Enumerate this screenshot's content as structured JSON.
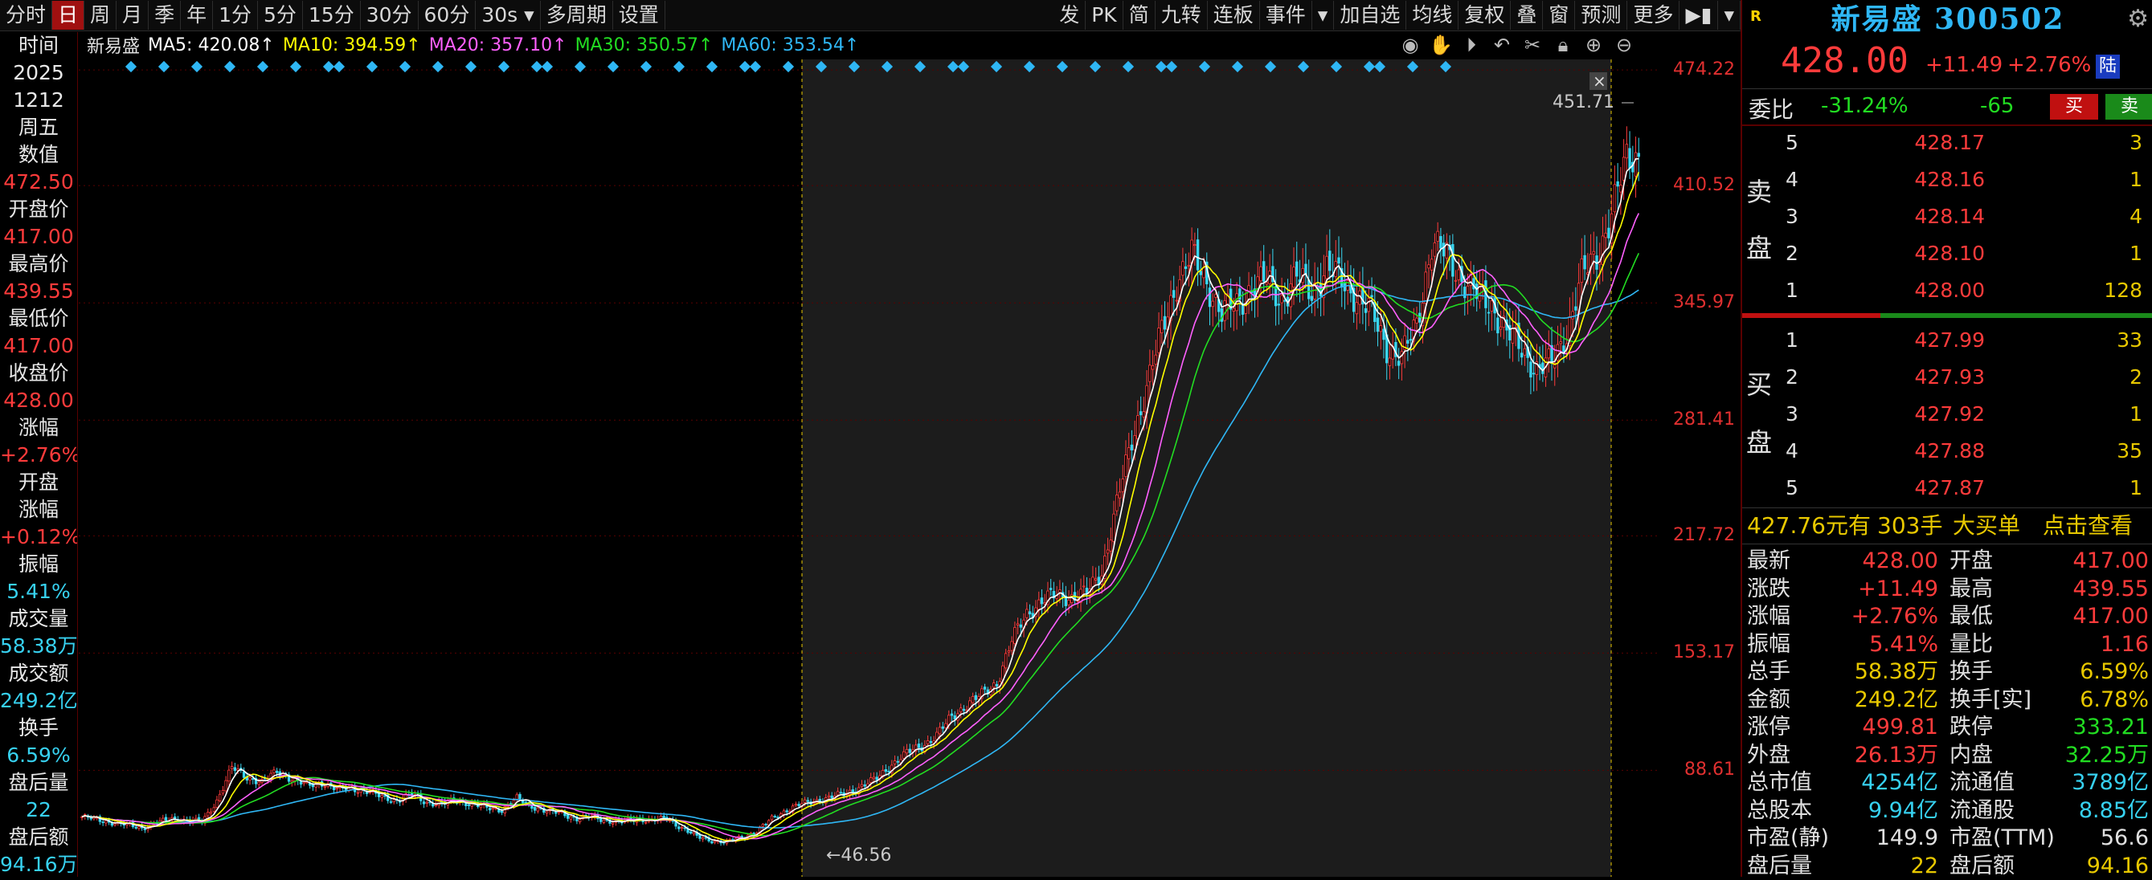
{
  "toolbar": {
    "left_items": [
      "分时",
      "日",
      "周",
      "月",
      "季",
      "年",
      "1分",
      "5分",
      "15分",
      "30分",
      "60分",
      "30s ▾",
      "多周期",
      "设置"
    ],
    "active_index": 1,
    "right_items": [
      "发",
      "PK",
      "简",
      "九转",
      "连板",
      "事件",
      "▾",
      "加自选",
      "均线",
      "复权",
      "叠",
      "窗",
      "预测",
      "更多",
      "▶▮",
      "▾"
    ]
  },
  "legend": {
    "name": "新易盛",
    "ma5": "MA5: 420.08↑",
    "ma10": "MA10: 394.59↑",
    "ma20": "MA20: 357.10↑",
    "ma30": "MA30: 350.57↑",
    "ma60": "MA60: 353.54↑"
  },
  "left_info": [
    {
      "label": "时间",
      "value": "2025"
    },
    {
      "label": "",
      "value": "1212"
    },
    {
      "label": "周五",
      "value": ""
    },
    {
      "label": "数值",
      "value": "472.50"
    },
    {
      "label": "开盘价",
      "value": "417.00"
    },
    {
      "label": "最高价",
      "value": "439.55"
    },
    {
      "label": "最低价",
      "value": "417.00"
    },
    {
      "label": "收盘价",
      "value": "428.00"
    },
    {
      "label": "涨幅",
      "value": "+2.76%"
    },
    {
      "label": "开盘",
      "value": ""
    },
    {
      "label": "涨幅",
      "value": "+0.12%"
    },
    {
      "label": "振幅",
      "value": "5.41%"
    },
    {
      "label": "成交量",
      "value": "58.38万"
    },
    {
      "label": "成交额",
      "value": "249.2亿"
    },
    {
      "label": "换手",
      "value": "6.59%"
    },
    {
      "label": "盘后量",
      "value": "22"
    },
    {
      "label": "盘后额",
      "value": "94.16万"
    }
  ],
  "y_axis_labels": [
    "474.22",
    "410.52",
    "345.97",
    "281.41",
    "217.72",
    "153.17",
    "88.61"
  ],
  "annotations": {
    "high": "451.71",
    "low": "46.56"
  },
  "chart_data": {
    "type": "candlestick",
    "title": "新易盛",
    "ylim": [
      30,
      480
    ],
    "high_label": 451.71,
    "low_label": 46.56,
    "close_path": [
      [
        0,
        63
      ],
      [
        10,
        60
      ],
      [
        20,
        57
      ],
      [
        30,
        62
      ],
      [
        40,
        60
      ],
      [
        45,
        72
      ],
      [
        50,
        90
      ],
      [
        55,
        85
      ],
      [
        60,
        82
      ],
      [
        65,
        88
      ],
      [
        70,
        84
      ],
      [
        75,
        80
      ],
      [
        80,
        82
      ],
      [
        85,
        78
      ],
      [
        90,
        79
      ],
      [
        95,
        77
      ],
      [
        100,
        74
      ],
      [
        105,
        72
      ],
      [
        110,
        75
      ],
      [
        115,
        71
      ],
      [
        120,
        70
      ],
      [
        125,
        72
      ],
      [
        130,
        70
      ],
      [
        135,
        68
      ],
      [
        140,
        67
      ],
      [
        145,
        73
      ],
      [
        150,
        69
      ],
      [
        155,
        66
      ],
      [
        160,
        65
      ],
      [
        165,
        62
      ],
      [
        170,
        63
      ],
      [
        175,
        61
      ],
      [
        180,
        60
      ],
      [
        185,
        62
      ],
      [
        190,
        61
      ],
      [
        195,
        62
      ],
      [
        200,
        57
      ],
      [
        205,
        52
      ],
      [
        210,
        50
      ],
      [
        215,
        49
      ],
      [
        220,
        52
      ],
      [
        225,
        55
      ],
      [
        230,
        62
      ],
      [
        235,
        67
      ],
      [
        240,
        70
      ],
      [
        245,
        72
      ],
      [
        250,
        74
      ],
      [
        255,
        76
      ],
      [
        260,
        80
      ],
      [
        265,
        84
      ],
      [
        270,
        92
      ],
      [
        275,
        98
      ],
      [
        280,
        102
      ],
      [
        285,
        108
      ],
      [
        290,
        118
      ],
      [
        295,
        125
      ],
      [
        300,
        130
      ],
      [
        305,
        137
      ],
      [
        310,
        160
      ],
      [
        315,
        175
      ],
      [
        320,
        182
      ],
      [
        325,
        185
      ],
      [
        330,
        184
      ],
      [
        335,
        186
      ],
      [
        340,
        198
      ],
      [
        345,
        235
      ],
      [
        350,
        270
      ],
      [
        355,
        300
      ],
      [
        360,
        330
      ],
      [
        365,
        358
      ],
      [
        370,
        372
      ],
      [
        375,
        358
      ],
      [
        380,
        340
      ],
      [
        385,
        345
      ],
      [
        390,
        355
      ],
      [
        395,
        358
      ],
      [
        400,
        348
      ],
      [
        405,
        360
      ],
      [
        410,
        352
      ],
      [
        415,
        365
      ],
      [
        420,
        358
      ],
      [
        425,
        350
      ],
      [
        430,
        340
      ],
      [
        435,
        322
      ],
      [
        440,
        315
      ],
      [
        445,
        335
      ],
      [
        450,
        378
      ],
      [
        455,
        372
      ],
      [
        460,
        360
      ],
      [
        465,
        350
      ],
      [
        470,
        345
      ],
      [
        475,
        330
      ],
      [
        480,
        320
      ],
      [
        485,
        310
      ],
      [
        490,
        312
      ],
      [
        495,
        330
      ],
      [
        500,
        360
      ],
      [
        505,
        372
      ],
      [
        510,
        395
      ],
      [
        515,
        425
      ],
      [
        519,
        428
      ]
    ],
    "ma_last": {
      "MA5": 420.08,
      "MA10": 394.59,
      "MA20": 357.1,
      "MA30": 350.57,
      "MA60": 353.54
    },
    "colors": {
      "up": "#ff3b3b",
      "down": "#38d6f0",
      "MA5": "#ffffff",
      "MA10": "#ffff00",
      "MA20": "#ff60ff",
      "MA30": "#22dd22",
      "MA60": "#2fb7f5"
    }
  },
  "panel": {
    "title": "新易盛 300502",
    "price": "428.00",
    "change": "+11.49",
    "change_pct": "+2.76%",
    "lu": "陆",
    "weibi_label": "委比",
    "weibi_pct": "-31.24%",
    "weibi_diff": "-65",
    "buy_btn": "买",
    "sell_btn": "卖",
    "sell_side_label": [
      "卖",
      "盘"
    ],
    "buy_side_label": [
      "买",
      "盘"
    ],
    "asks": [
      {
        "lvl": "5",
        "price": "428.17",
        "vol": "3"
      },
      {
        "lvl": "4",
        "price": "428.16",
        "vol": "1"
      },
      {
        "lvl": "3",
        "price": "428.14",
        "vol": "4"
      },
      {
        "lvl": "2",
        "price": "428.10",
        "vol": "1"
      },
      {
        "lvl": "1",
        "price": "428.00",
        "vol": "128"
      }
    ],
    "bids": [
      {
        "lvl": "1",
        "price": "427.99",
        "vol": "33"
      },
      {
        "lvl": "2",
        "price": "427.93",
        "vol": "2"
      },
      {
        "lvl": "3",
        "price": "427.92",
        "vol": "1"
      },
      {
        "lvl": "4",
        "price": "427.88",
        "vol": "35"
      },
      {
        "lvl": "5",
        "price": "427.87",
        "vol": "1"
      }
    ],
    "big_order": {
      "price": "427.76元有",
      "qty": "303手",
      "label": "大买单",
      "action": "点击查看"
    },
    "stats": [
      {
        "k1": "最新",
        "v1": "428.00",
        "c1": "up",
        "k2": "开盘",
        "v2": "417.00",
        "c2": "up"
      },
      {
        "k1": "涨跌",
        "v1": "+11.49",
        "c1": "up",
        "k2": "最高",
        "v2": "439.55",
        "c2": "up"
      },
      {
        "k1": "涨幅",
        "v1": "+2.76%",
        "c1": "up",
        "k2": "最低",
        "v2": "417.00",
        "c2": "up"
      },
      {
        "k1": "振幅",
        "v1": "5.41%",
        "c1": "up",
        "k2": "量比",
        "v2": "1.16",
        "c2": "up"
      },
      {
        "k1": "总手",
        "v1": "58.38万",
        "c1": "ye",
        "k2": "换手",
        "v2": "6.59%",
        "c2": "ye"
      },
      {
        "k1": "金额",
        "v1": "249.2亿",
        "c1": "ye",
        "k2": "换手[实]",
        "v2": "6.78%",
        "c2": "ye"
      },
      {
        "k1": "涨停",
        "v1": "499.81",
        "c1": "up",
        "k2": "跌停",
        "v2": "333.21",
        "c2": "dn"
      },
      {
        "k1": "外盘",
        "v1": "26.13万",
        "c1": "up",
        "k2": "内盘",
        "v2": "32.25万",
        "c2": "dn"
      },
      {
        "k1": "总市值",
        "v1": "4254亿",
        "c1": "cy",
        "k2": "流通值",
        "v2": "3789亿",
        "c2": "cy"
      },
      {
        "k1": "总股本",
        "v1": "9.94亿",
        "c1": "cy",
        "k2": "流通股",
        "v2": "8.85亿",
        "c2": "cy"
      },
      {
        "k1": "市盈(静)",
        "v1": "149.9",
        "c1": "wh",
        "k2": "市盈(TTM)",
        "v2": "56.6",
        "c2": "wh"
      },
      {
        "k1": "盘后量",
        "v1": "22",
        "c1": "ye",
        "k2": "盘后额",
        "v2": "94.16",
        "c2": "ye"
      }
    ]
  }
}
